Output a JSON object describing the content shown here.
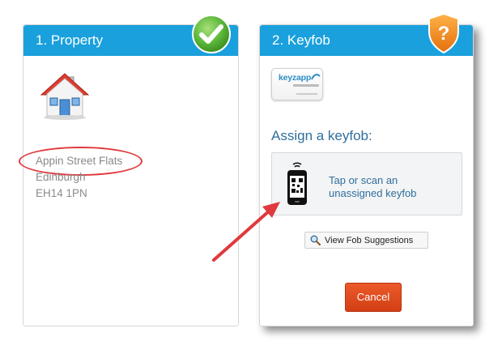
{
  "property": {
    "header": "1. Property",
    "address_line1": "Appin Street Flats",
    "address_line2": "Edinburgh",
    "address_line3": "EH14 1PN"
  },
  "keyfob": {
    "header": "2. Keyfob",
    "logo_text": "keyzapp",
    "assign_title": "Assign a keyfob:",
    "tap_line1": "Tap or scan an",
    "tap_line2": "unassigned keyfob",
    "suggestions_button": "View Fob Suggestions",
    "cancel_button": "Cancel"
  },
  "icons": {
    "property_badge": "checkmark-icon",
    "keyfob_badge": "question-shield-icon",
    "house": "house-icon",
    "phone": "phone-qr-icon",
    "magnifier": "magnifier-icon"
  },
  "colors": {
    "header_blue": "#1aa0dc",
    "accent_text": "#2f6f9d",
    "cancel_orange": "#e04e20",
    "highlight_red": "#e0393e",
    "check_green": "#5cb83a",
    "shield_orange": "#f08a1c"
  }
}
